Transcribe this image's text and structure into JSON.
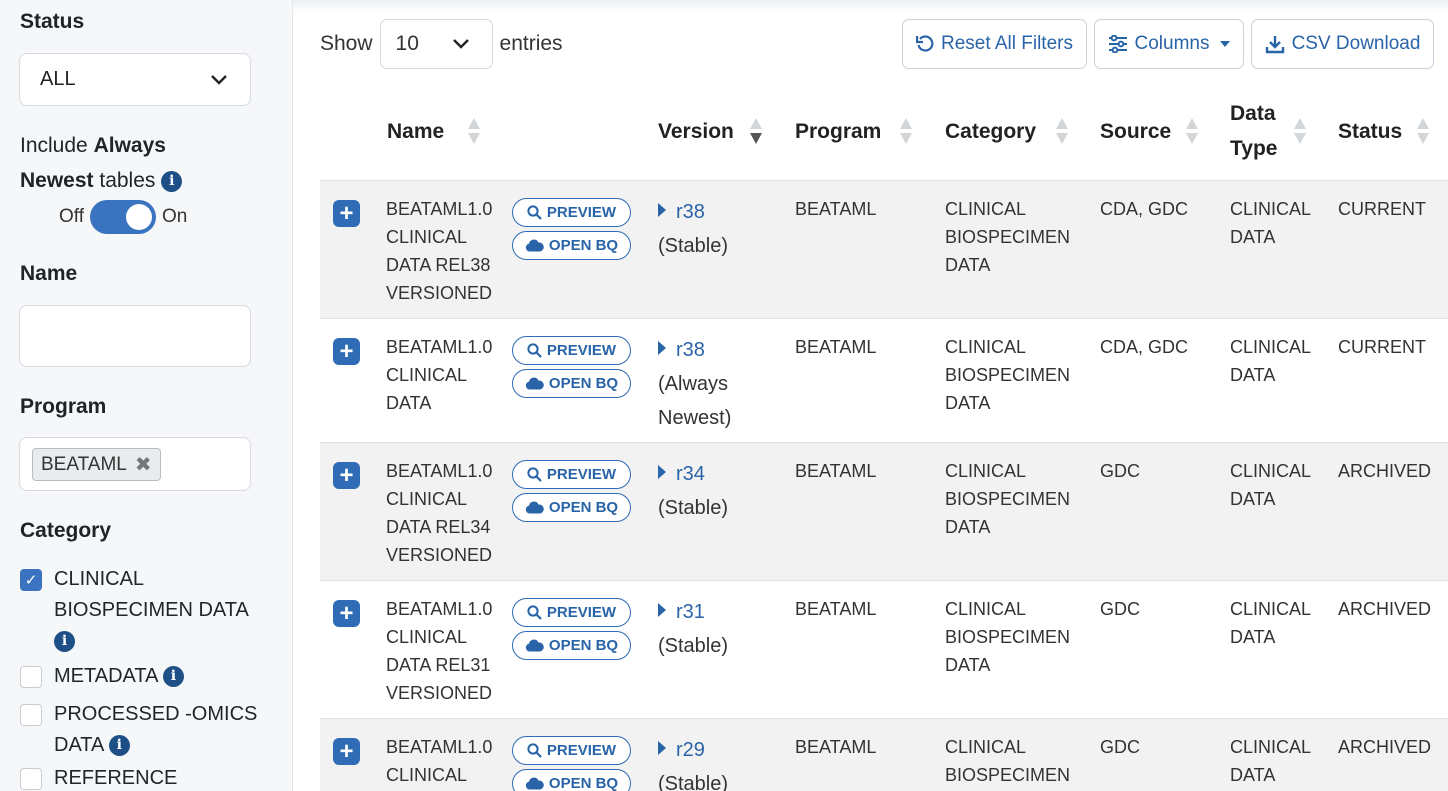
{
  "sidebar": {
    "status_heading": "Status",
    "status_value": "ALL",
    "include_prefix": "Include ",
    "include_bold_1": "Always",
    "include_bold_2": "Newest",
    "include_suffix": " tables",
    "toggle_off": "Off",
    "toggle_on": "On",
    "name_heading": "Name",
    "program_heading": "Program",
    "program_chip": "BEATAML",
    "category_heading": "Category",
    "categories": [
      {
        "label_1": "CLINICAL",
        "label_2": "BIOSPECIMEN DATA",
        "checked": true
      },
      {
        "label_1": "METADATA",
        "checked": false
      },
      {
        "label_1": "PROCESSED -OMICS",
        "label_2": "DATA",
        "checked": false
      },
      {
        "label_1": "REFERENCE",
        "checked": false
      }
    ]
  },
  "toolbar": {
    "show_label": "Show",
    "entries_value": "10",
    "entries_label": "entries",
    "reset_label": "Reset All Filters",
    "columns_label": "Columns",
    "csv_label": "CSV Download"
  },
  "table": {
    "headers": {
      "name": "Name",
      "version": "Version",
      "program": "Program",
      "category": "Category",
      "source": "Source",
      "data_type_1": "Data",
      "data_type_2": "Type",
      "status": "Status"
    },
    "preview_label": "PREVIEW",
    "open_bq_label": "OPEN BQ",
    "rows": [
      {
        "name": [
          "BEATAML1.0",
          "CLINICAL",
          "DATA REL38",
          "VERSIONED"
        ],
        "version": "r38",
        "version_note": [
          "(Stable)"
        ],
        "program": "BEATAML",
        "category": [
          "CLINICAL",
          "BIOSPECIMEN",
          "DATA"
        ],
        "source": "CDA, GDC",
        "data_type": [
          "CLINICAL",
          "DATA"
        ],
        "status": "CURRENT"
      },
      {
        "name": [
          "BEATAML1.0",
          "CLINICAL",
          "DATA"
        ],
        "version": "r38",
        "version_note": [
          "(Always",
          "Newest)"
        ],
        "program": "BEATAML",
        "category": [
          "CLINICAL",
          "BIOSPECIMEN",
          "DATA"
        ],
        "source": "CDA, GDC",
        "data_type": [
          "CLINICAL",
          "DATA"
        ],
        "status": "CURRENT"
      },
      {
        "name": [
          "BEATAML1.0",
          "CLINICAL",
          "DATA REL34",
          "VERSIONED"
        ],
        "version": "r34",
        "version_note": [
          "(Stable)"
        ],
        "program": "BEATAML",
        "category": [
          "CLINICAL",
          "BIOSPECIMEN",
          "DATA"
        ],
        "source": "GDC",
        "data_type": [
          "CLINICAL",
          "DATA"
        ],
        "status": "ARCHIVED"
      },
      {
        "name": [
          "BEATAML1.0",
          "CLINICAL",
          "DATA REL31",
          "VERSIONED"
        ],
        "version": "r31",
        "version_note": [
          "(Stable)"
        ],
        "program": "BEATAML",
        "category": [
          "CLINICAL",
          "BIOSPECIMEN",
          "DATA"
        ],
        "source": "GDC",
        "data_type": [
          "CLINICAL",
          "DATA"
        ],
        "status": "ARCHIVED"
      },
      {
        "name": [
          "BEATAML1.0",
          "CLINICAL"
        ],
        "version": "r29",
        "version_note": [
          "(Stable)"
        ],
        "program": "BEATAML",
        "category": [
          "CLINICAL",
          "BIOSPECIMEN"
        ],
        "source": "GDC",
        "data_type": [
          "CLINICAL",
          "DATA"
        ],
        "status": "ARCHIVED"
      }
    ]
  },
  "colors": {
    "accent": "#2f6cb5",
    "info": "#1e4f86",
    "row_shade": "#f2f2f2"
  }
}
